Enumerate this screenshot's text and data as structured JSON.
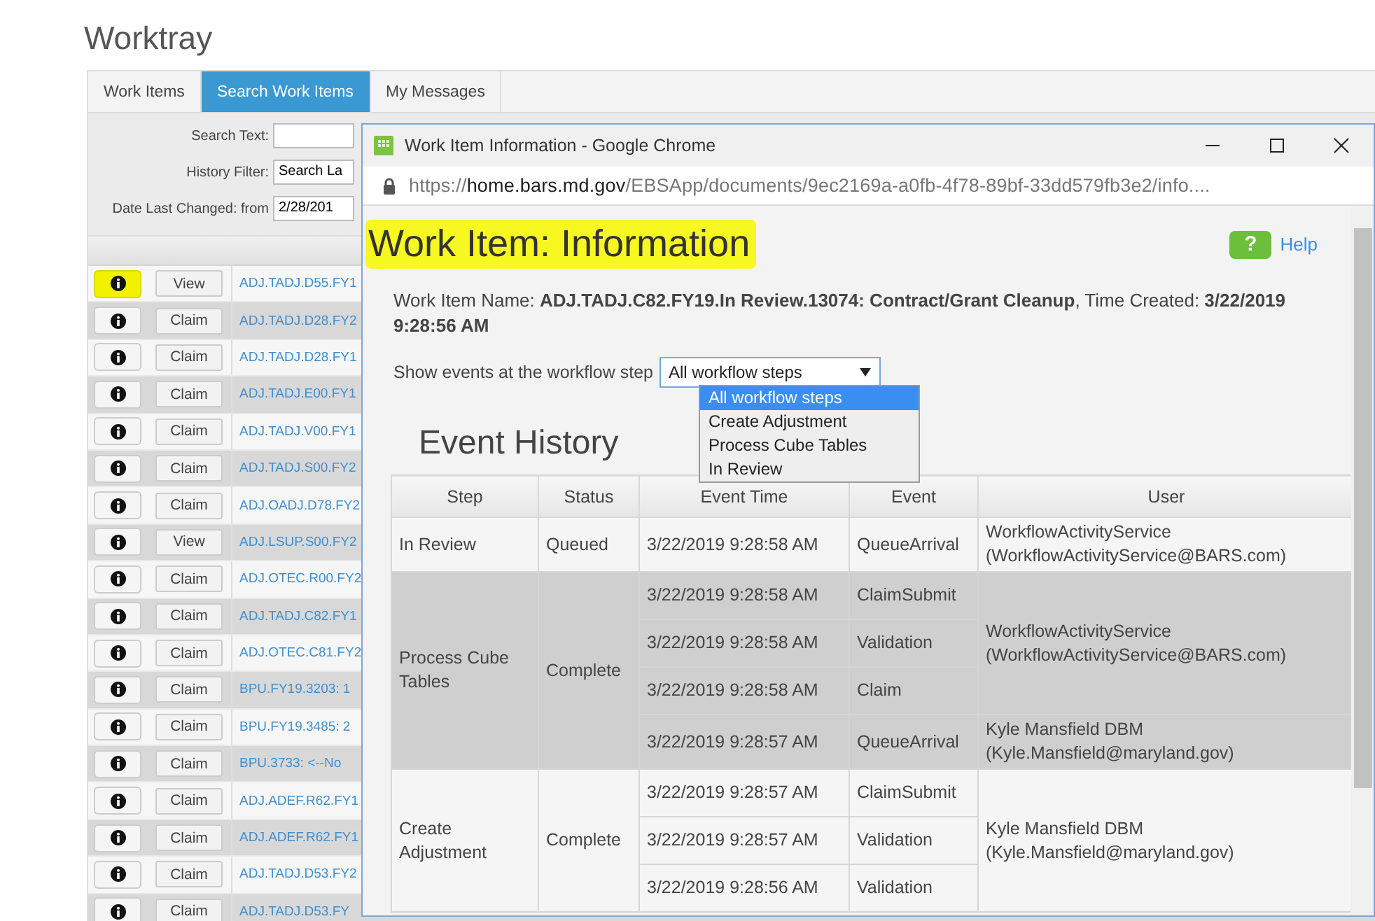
{
  "page_title": "Worktray",
  "tabs": [
    {
      "label": "Work Items",
      "selected": false
    },
    {
      "label": "Search Work Items",
      "selected": true
    },
    {
      "label": "My Messages",
      "selected": false
    }
  ],
  "search_form": {
    "search_text_label": "Search Text:",
    "history_filter_label": "History Filter:",
    "history_filter_value": "Search La",
    "date_label": "Date Last Changed: from",
    "date_value": "2/28/201"
  },
  "work_items": [
    {
      "action": "View",
      "name": "ADJ.TADJ.D55.FY1",
      "highlighted": true
    },
    {
      "action": "Claim",
      "name": "ADJ.TADJ.D28.FY2",
      "highlighted": false
    },
    {
      "action": "Claim",
      "name": "ADJ.TADJ.D28.FY1",
      "highlighted": false
    },
    {
      "action": "Claim",
      "name": "ADJ.TADJ.E00.FY1",
      "highlighted": false
    },
    {
      "action": "Claim",
      "name": "ADJ.TADJ.V00.FY1",
      "highlighted": false
    },
    {
      "action": "Claim",
      "name": "ADJ.TADJ.S00.FY2",
      "highlighted": false
    },
    {
      "action": "Claim",
      "name": "ADJ.OADJ.D78.FY2",
      "highlighted": false
    },
    {
      "action": "View",
      "name": "ADJ.LSUP.S00.FY2",
      "highlighted": false
    },
    {
      "action": "Claim",
      "name": "ADJ.OTEC.R00.FY2",
      "highlighted": false
    },
    {
      "action": "Claim",
      "name": "ADJ.TADJ.C82.FY1",
      "highlighted": false
    },
    {
      "action": "Claim",
      "name": "ADJ.OTEC.C81.FY2",
      "highlighted": false
    },
    {
      "action": "Claim",
      "name": "BPU.FY19.3203: 1",
      "highlighted": false
    },
    {
      "action": "Claim",
      "name": "BPU.FY19.3485: 2",
      "highlighted": false
    },
    {
      "action": "Claim",
      "name": "BPU.3733: <--No",
      "highlighted": false
    },
    {
      "action": "Claim",
      "name": "ADJ.ADEF.R62.FY1",
      "highlighted": false
    },
    {
      "action": "Claim",
      "name": "ADJ.ADEF.R62.FY1",
      "highlighted": false
    },
    {
      "action": "Claim",
      "name": "ADJ.TADJ.D53.FY2",
      "highlighted": false
    },
    {
      "action": "Claim",
      "name": "ADJ.TADJ.D53.FY",
      "highlighted": false
    }
  ],
  "popup": {
    "window_title": "Work Item Information - Google Chrome",
    "url": {
      "scheme": "https://",
      "host": "home.bars.md.gov",
      "path": "/EBSApp/documents/9ec2169a-a0fb-4f78-89bf-33dd579fb3e2/info...."
    },
    "heading": {
      "text": "Work Item: Information",
      "highlighted": true
    },
    "help_glyph": "?",
    "help_link": "Help",
    "work_item_line": "Work Item Name: **ADJ.TADJ.C82.FY19.In Review.13074: Contract/Grant Cleanup**, Time Created: **3/22/2019 9:28:56 AM**",
    "step_filter_label": "Show events at the workflow step",
    "step_filter_value": "All workflow steps",
    "step_options": [
      {
        "label": "All workflow steps",
        "selected": true
      },
      {
        "label": "Create Adjustment",
        "selected": false
      },
      {
        "label": "Process Cube Tables",
        "selected": false
      },
      {
        "label": "In Review",
        "selected": false
      }
    ],
    "event_history_title": "Event History",
    "columns": [
      "Step",
      "Status",
      "Event Time",
      "Event",
      "User"
    ],
    "steps": [
      {
        "step": "In Review",
        "status": "Queued",
        "user_groups": [
          {
            "user": "WorkflowActivityService (WorkflowActivityService@BARS.com)",
            "events": [
              {
                "time": "3/22/2019 9:28:58 AM",
                "event": "QueueArrival"
              }
            ]
          }
        ]
      },
      {
        "step": "Process Cube Tables",
        "status": "Complete",
        "user_groups": [
          {
            "user": "WorkflowActivityService (WorkflowActivityService@BARS.com)",
            "events": [
              {
                "time": "3/22/2019 9:28:58 AM",
                "event": "ClaimSubmit"
              },
              {
                "time": "3/22/2019 9:28:58 AM",
                "event": "Validation"
              },
              {
                "time": "3/22/2019 9:28:58 AM",
                "event": "Claim"
              }
            ]
          },
          {
            "user": "Kyle Mansfield DBM (Kyle.Mansfield@maryland.gov)",
            "events": [
              {
                "time": "3/22/2019 9:28:57 AM",
                "event": "QueueArrival"
              }
            ]
          }
        ]
      },
      {
        "step": "Create Adjustment",
        "status": "Complete",
        "user_groups": [
          {
            "user": "Kyle Mansfield DBM (Kyle.Mansfield@maryland.gov)",
            "events": [
              {
                "time": "3/22/2019 9:28:57 AM",
                "event": "ClaimSubmit"
              },
              {
                "time": "3/22/2019 9:28:57 AM",
                "event": "Validation"
              },
              {
                "time": "3/22/2019 9:28:56 AM",
                "event": "Validation"
              }
            ]
          }
        ]
      }
    ]
  }
}
